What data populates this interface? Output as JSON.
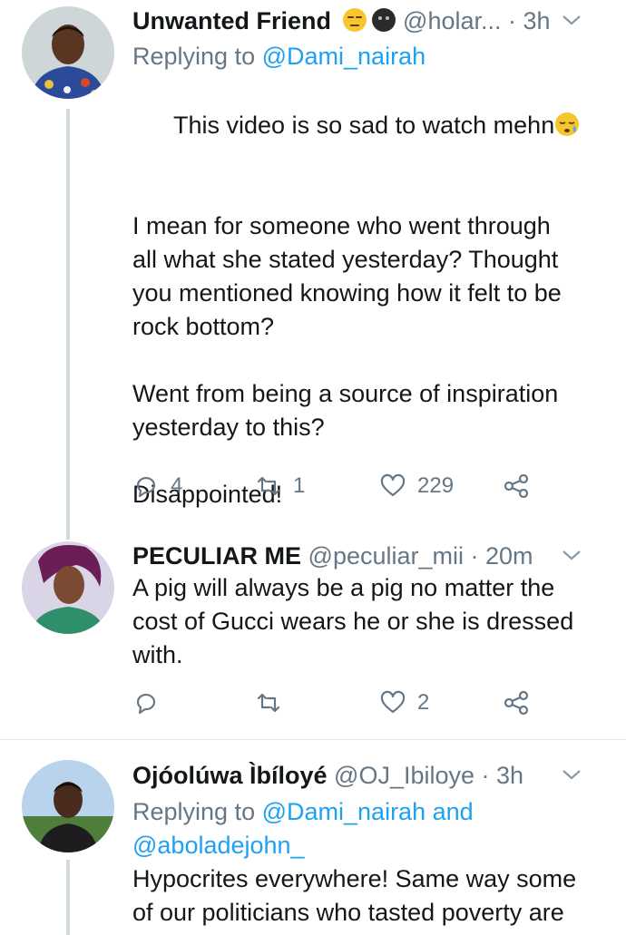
{
  "tweets": [
    {
      "name": "Unwanted Friend",
      "handle": "@holar...",
      "time": "3h",
      "emojis": [
        "unamused-face",
        "dark-circle-face"
      ],
      "replying_label": "Replying to",
      "replying_to": "@Dami_nairah",
      "text_line": "This video is so sad to watch mehn",
      "text_emoji": "sleepy-face",
      "text_rest": "I mean for someone who went through\nall what she stated yesterday? Thought\nyou mentioned knowing how it felt to be\nrock bottom?\n\nWent from being a source of inspiration\nyesterday to this?\n\nDisappointed!",
      "replies": "4",
      "retweets": "1",
      "likes": "229"
    },
    {
      "name": "PECULIAR ME",
      "handle": "@peculiar_mii",
      "time": "20m",
      "text": "A pig will always be a pig no matter the\ncost of Gucci wears he or she is dressed\nwith.",
      "replies": "",
      "retweets": "",
      "likes": "2"
    },
    {
      "name": "Ojóolúwa Ìbíloyé",
      "handle": "@OJ_Ibiloye",
      "time": "3h",
      "replying_label": "Replying to",
      "replying_to": "@Dami_nairah and\n@aboladejohn_",
      "text": "Hypocrites everywhere! Same way some\nof our politicians who tasted poverty are"
    }
  ],
  "colors": {
    "link": "#1da1f2",
    "muted": "#657786",
    "text": "#14171a",
    "divider": "#e1e8ed"
  }
}
